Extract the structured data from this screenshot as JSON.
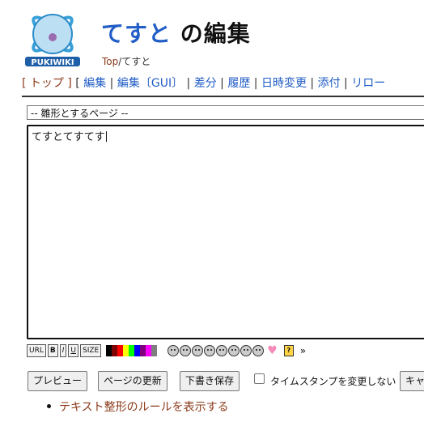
{
  "logo": {
    "text": "PUKIWIKI",
    "icon": "pukiwiki-logo"
  },
  "header": {
    "page_name": "てすと",
    "title_suffix": " の編集",
    "breadcrumb_top": "Top",
    "breadcrumb_sep": "/",
    "breadcrumb_current": "てすと"
  },
  "menu": {
    "open1": "[ ",
    "top": "トップ",
    "close1": " ]",
    "open2": "  [ ",
    "edit": "編集",
    "sep": " | ",
    "edit_gui": "編集〔GUI〕",
    "diff": "差分",
    "history": "履歴",
    "timestamp": "日時変更",
    "attach": "添付",
    "reload": "リロー"
  },
  "editor": {
    "template_select": "-- 雛形とするページ --",
    "content": "てすとてすてす"
  },
  "toolbar": {
    "url": "URL",
    "bold": "B",
    "italic": "I",
    "underline": "U",
    "size": "SIZE",
    "more": "»",
    "colors": [
      "#000000",
      "#7f0000",
      "#ff0000",
      "#ffff00",
      "#00ff00",
      "#0000ff",
      "#7f007f",
      "#ff00ff",
      "#7f7f7f",
      "#ffffff"
    ],
    "faces": [
      "smile",
      "bigsmile",
      "huh",
      "oh",
      "wink",
      "sad",
      "worried",
      "tear"
    ]
  },
  "buttons": {
    "preview": "プレビュー",
    "update": "ページの更新",
    "draft": "下書き保存",
    "notimestamp": "タイムスタンプを変更しない",
    "cancel": "キャ"
  },
  "links": {
    "rules": "テキスト整形のルールを表示する"
  }
}
